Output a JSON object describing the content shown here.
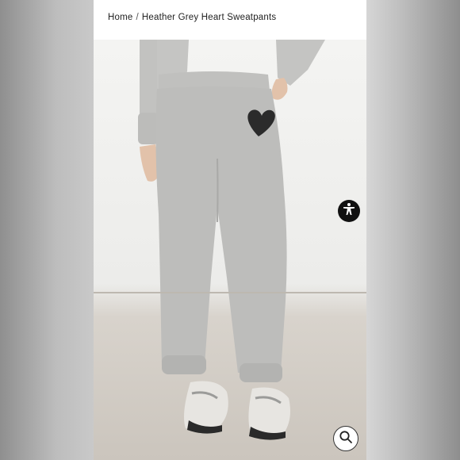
{
  "breadcrumb": {
    "home": "Home",
    "separator": "/",
    "current": "Heather Grey Heart Sweatpants"
  },
  "product_image": {
    "alt": "Heather Grey Heart Sweatpants"
  },
  "icons": {
    "accessibility": "accessibility-icon",
    "zoom": "magnifier-icon"
  },
  "colors": {
    "heather_grey": "#bdbdbb",
    "heart": "#2b2b2b",
    "accent_dark": "#111111"
  }
}
